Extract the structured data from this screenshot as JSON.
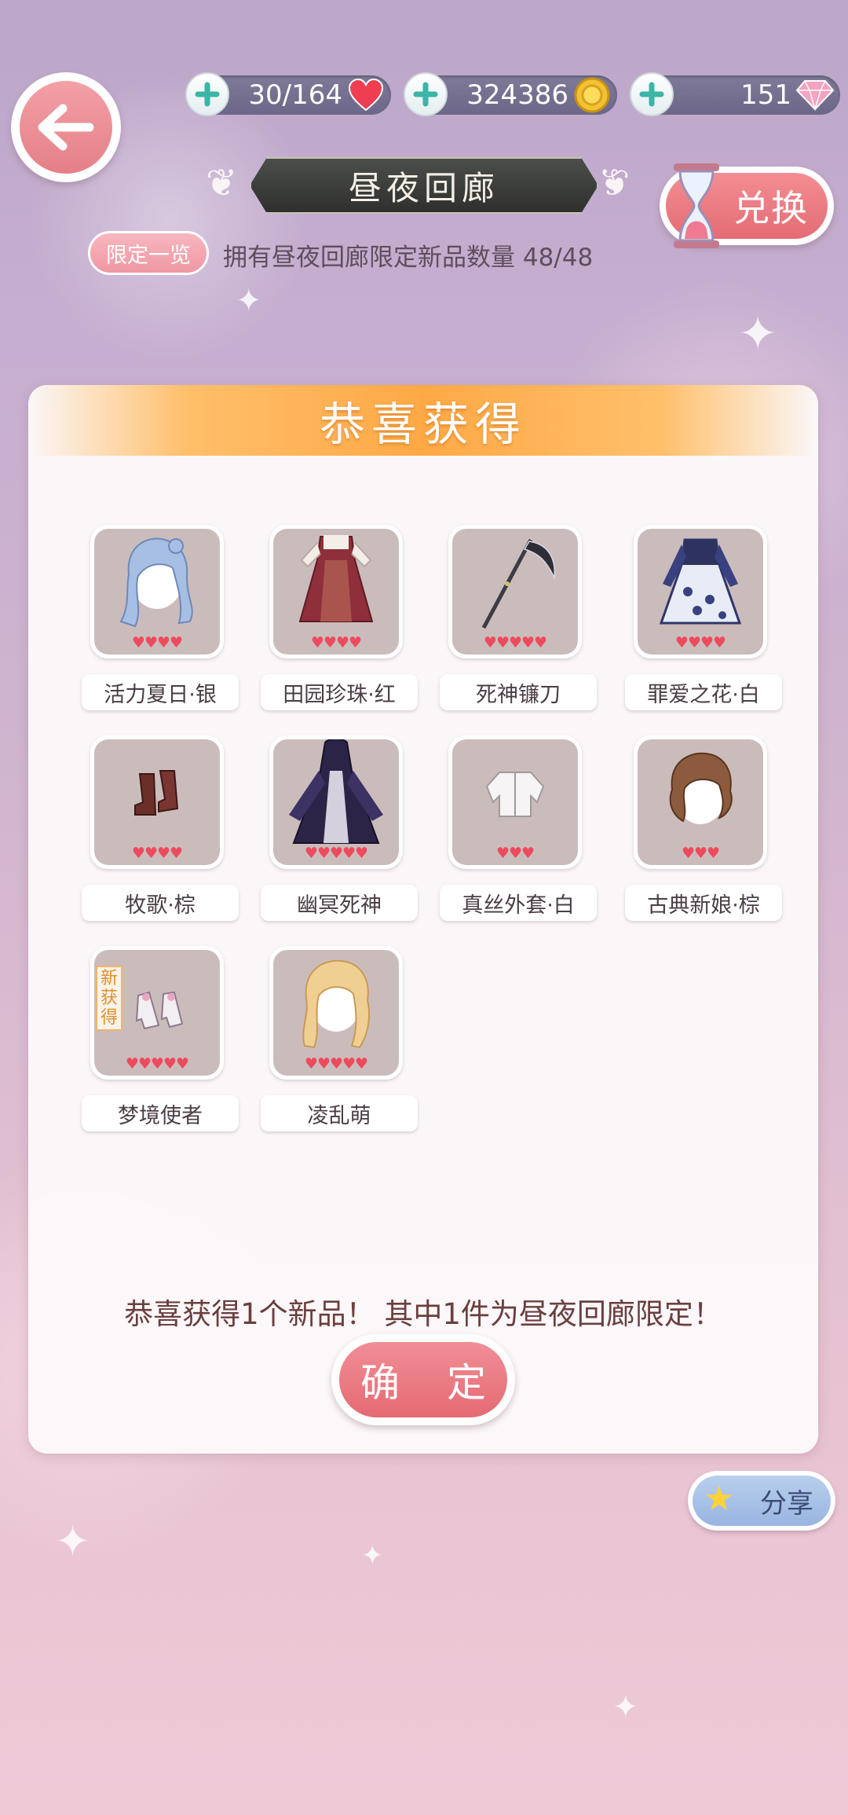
{
  "resources": {
    "stamina": {
      "value": "30/164",
      "icon": "heart-icon"
    },
    "coins": {
      "value": "324386",
      "icon": "coin-icon"
    },
    "diamonds": {
      "value": "151",
      "icon": "diamond-icon"
    }
  },
  "header": {
    "title": "昼夜回廊",
    "exchange_label": "兑换",
    "limited_label": "限定一览",
    "owned_text": "拥有昼夜回廊限定新品数量 48/48"
  },
  "dialog": {
    "banner": "恭喜获得",
    "items": [
      {
        "name": "活力夏日·银",
        "hearts": "♥♥♥♥",
        "kind": "hair-silver",
        "is_new": false
      },
      {
        "name": "田园珍珠·红",
        "hearts": "♥♥♥♥",
        "kind": "dress-red",
        "is_new": false
      },
      {
        "name": "死神镰刀",
        "hearts": "♥♥♥♥♥",
        "kind": "scythe",
        "is_new": false
      },
      {
        "name": "罪爱之花·白",
        "hearts": "♥♥♥♥",
        "kind": "dress-blue",
        "is_new": false
      },
      {
        "name": "牧歌·棕",
        "hearts": "♥♥♥♥",
        "kind": "boots",
        "is_new": false
      },
      {
        "name": "幽冥死神",
        "hearts": "♥♥♥♥♥",
        "kind": "dress-dark",
        "is_new": false
      },
      {
        "name": "真丝外套·白",
        "hearts": "♥♥♥",
        "kind": "jacket",
        "is_new": false
      },
      {
        "name": "古典新娘·棕",
        "hearts": "♥♥♥",
        "kind": "hair-brown",
        "is_new": false
      },
      {
        "name": "梦境使者",
        "hearts": "♥♥♥♥♥",
        "kind": "shoes",
        "is_new": true
      },
      {
        "name": "凌乱萌",
        "hearts": "♥♥♥♥♥",
        "kind": "hair-blonde",
        "is_new": false
      }
    ],
    "new_tag": "新获得",
    "message": "恭喜获得1个新品！ 其中1件为昼夜回廊限定！",
    "confirm_label": "确 定"
  },
  "share_label": "分享",
  "colors": {
    "accent_pink": "#e56a74",
    "banner_orange": "#ffa945",
    "heart_red": "#ee4a5e"
  }
}
